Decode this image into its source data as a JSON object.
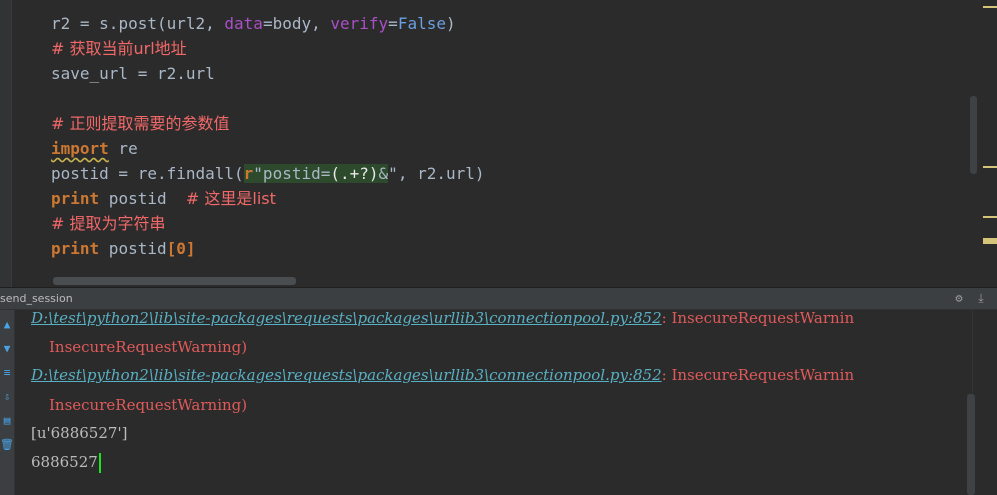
{
  "editor": {
    "lines": {
      "l1": {
        "var": "r2",
        "op": " = ",
        "call": "s.post(url2, ",
        "kw1": "data",
        "eq1": "=body, ",
        "kw2": "verify",
        "eq2": "=",
        "const": "False",
        "end": ")"
      },
      "l2": {
        "comment": "# 获取当前url地址"
      },
      "l3": {
        "text": "save_url = r2.url"
      },
      "l5": {
        "comment": "# 正则提取需要的参数值"
      },
      "l6": {
        "kw": "import",
        "rest": " re"
      },
      "l7": {
        "pre": "postid = re.findall(",
        "rprefix": "r",
        "strq": "\"postid=",
        "group": "(.+?)",
        "amp": "&",
        "strend": "\"",
        "post": ", r2.url)"
      },
      "l8": {
        "kw": "print",
        "rest": " postid  ",
        "comment": "# 这里是list"
      },
      "l9": {
        "comment": "# 提取为字符串"
      },
      "l10": {
        "kw": "print",
        "rest": " postid",
        "idx": "[0]"
      }
    }
  },
  "run_panel": {
    "title": "send_session",
    "output": {
      "warn1_path": "D:\\test\\python2\\lib\\site-packages\\requests\\packages\\urllib3\\connectionpool.py:852",
      "warn1_msg": ": InsecureRequestWarnin",
      "warn1_cont": "InsecureRequestWarning)",
      "warn2_path": "D:\\test\\python2\\lib\\site-packages\\requests\\packages\\urllib3\\connectionpool.py:852",
      "warn2_msg": ": InsecureRequestWarnin",
      "warn2_cont": "InsecureRequestWarning)",
      "result_list": "[u'6886527']",
      "result_str": "6886527"
    },
    "icons": {
      "settings": "gear-icon",
      "hide": "hide-icon",
      "up": "arrow-up-icon",
      "down": "arrow-down-icon",
      "wrap": "soft-wrap-icon",
      "scroll_end": "scroll-to-end-icon",
      "print": "print-icon",
      "trash": "trash-icon"
    }
  },
  "colors": {
    "background": "#2b2b2b",
    "keyword": "#cc7832",
    "comment": "#f26868",
    "link": "#58b0c4",
    "warning": "#e05a5a",
    "caret": "#19e619"
  }
}
